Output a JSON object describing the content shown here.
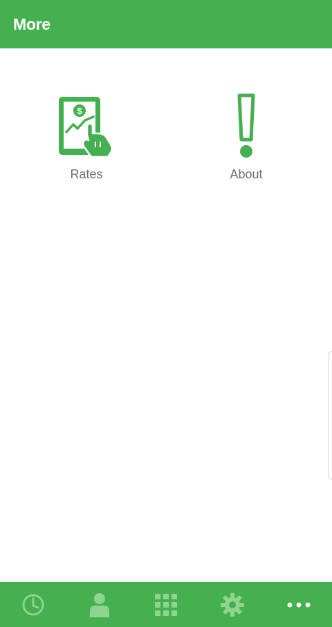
{
  "header": {
    "title": "More"
  },
  "tiles": [
    {
      "label": "Rates",
      "icon": "rates-icon"
    },
    {
      "label": "About",
      "icon": "exclamation-icon"
    }
  ],
  "bottom_nav": {
    "items": [
      {
        "icon": "clock-icon"
      },
      {
        "icon": "person-icon"
      },
      {
        "icon": "grid-icon"
      },
      {
        "icon": "gear-icon"
      },
      {
        "icon": "more-dots-icon",
        "active": true
      }
    ]
  },
  "colors": {
    "brand": "#45b04f",
    "nav_icon_inactive": "#8fd48f",
    "nav_icon_active": "#ffffff",
    "label": "#6e6e6e"
  }
}
